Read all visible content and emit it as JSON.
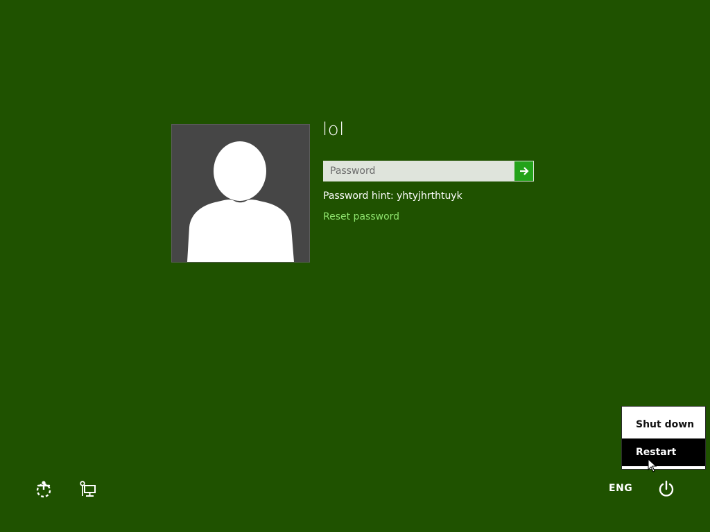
{
  "user": {
    "name": "lol"
  },
  "password": {
    "placeholder": "Password",
    "value": "",
    "submit_icon": "arrow-right-icon"
  },
  "hint": {
    "text": "Password hint: yhtyjhrthtuyk"
  },
  "reset": {
    "label": "Reset password"
  },
  "bottom_bar": {
    "ease_of_access_icon": "ease-of-access-icon",
    "network_icon": "network-icon",
    "language": "ENG",
    "power_icon": "power-icon"
  },
  "power_menu": {
    "items": [
      {
        "label": "Shut down"
      },
      {
        "label": "Restart"
      }
    ],
    "highlighted": "Restart"
  },
  "colors": {
    "background": "#1f5200",
    "accent_button": "#23a219",
    "link": "#8ee46d",
    "avatar_bg": "#464646"
  }
}
